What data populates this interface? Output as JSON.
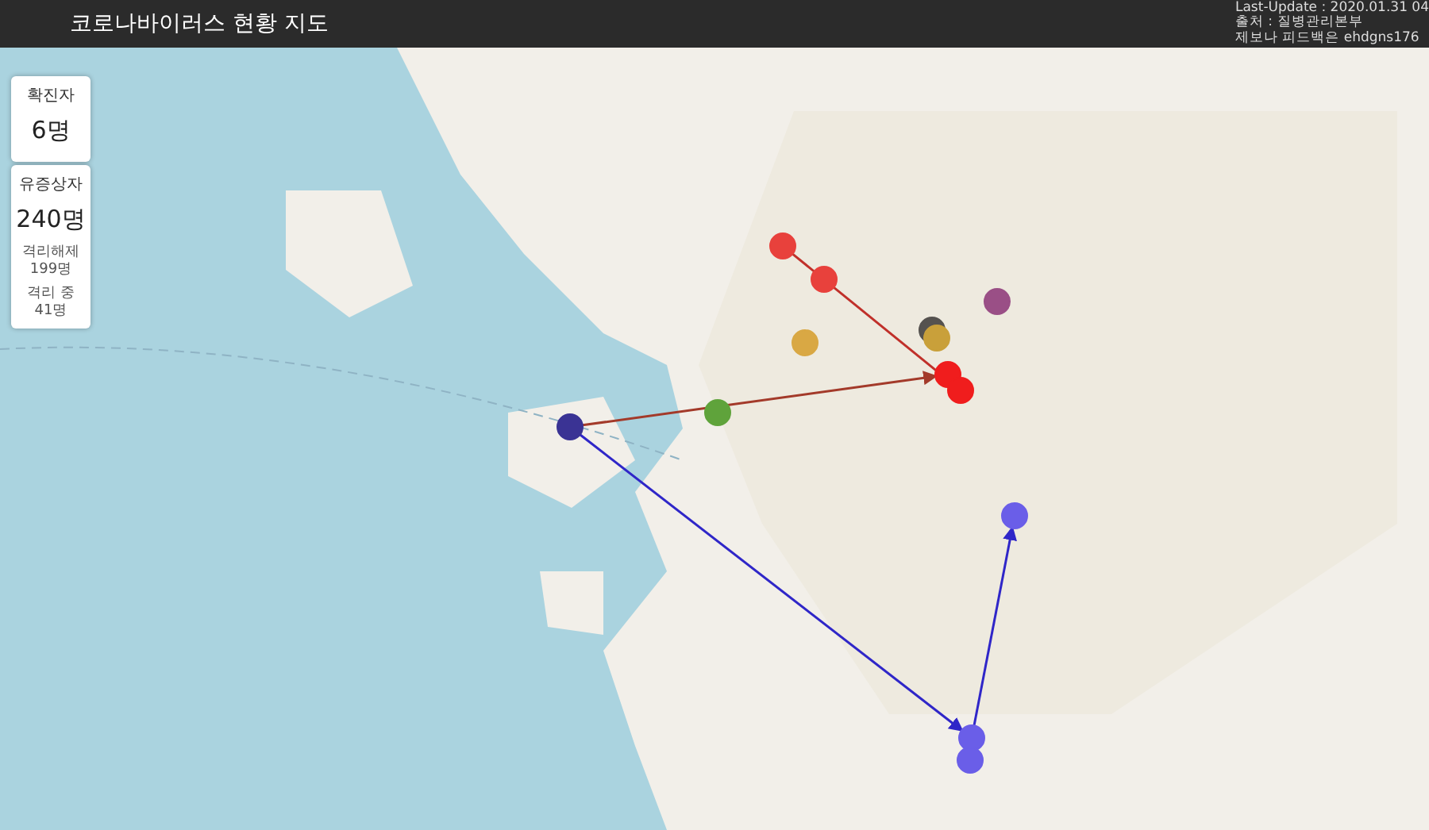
{
  "header": {
    "title": "코로나바이러스 현황 지도",
    "info": [
      "Last-Update : 2020.01.31 04",
      "출처 : 질병관리본부",
      "제보나 피드백은 ehdgns176"
    ]
  },
  "stats": [
    {
      "label": "확진자",
      "value": "6명"
    },
    {
      "label": "유증상자",
      "value": "240명",
      "details": [
        {
          "label": "격리해제",
          "value": "199명"
        },
        {
          "label": "격리 중",
          "value": "41명"
        }
      ]
    }
  ],
  "markers": [
    {
      "color": "#e8413c"
    },
    {
      "color": "#e8413c"
    },
    {
      "color": "#55524f"
    },
    {
      "color": "#c9a03a"
    },
    {
      "color": "#9a4f86"
    },
    {
      "color": "#d9a844"
    },
    {
      "color": "#f01d1d"
    },
    {
      "color": "#f01d1d"
    },
    {
      "color": "#5fa33b"
    },
    {
      "color": "#3a3394"
    },
    {
      "color": "#6a5ee8"
    },
    {
      "color": "#6a5ee8"
    },
    {
      "color": "#6a5ee8"
    }
  ],
  "routes": [
    {
      "color": "#c0302a"
    },
    {
      "color": "#a33a2a"
    },
    {
      "color": "#2f26c8"
    },
    {
      "color": "#2f26c8"
    }
  ]
}
